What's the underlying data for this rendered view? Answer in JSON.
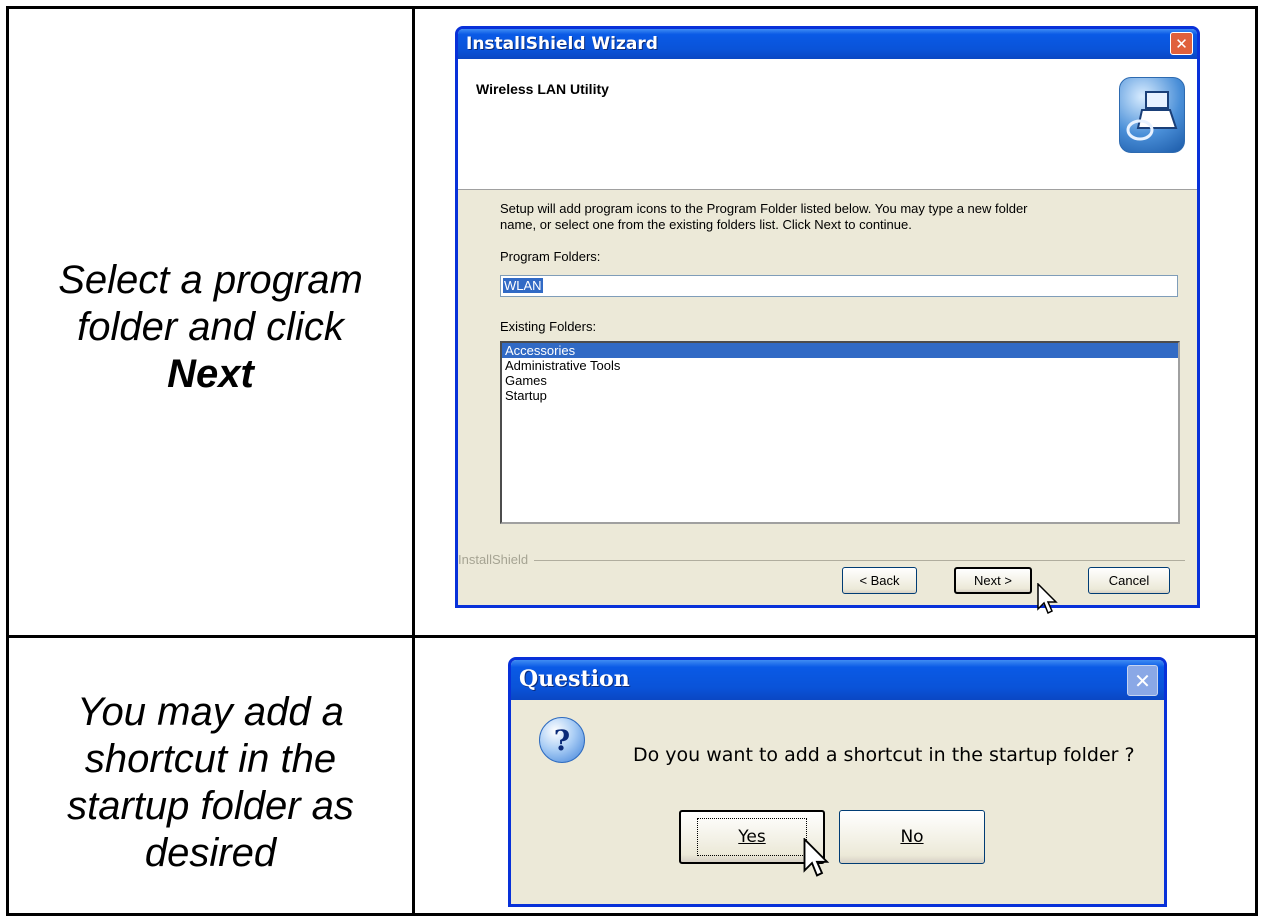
{
  "row1": {
    "instruction_line1": "Select a program",
    "instruction_line2": "folder and click",
    "instruction_bold": "Next"
  },
  "row2": {
    "instruction_line1": "You may add a",
    "instruction_line2": "shortcut in the",
    "instruction_line3": "startup folder as",
    "instruction_line4": "desired"
  },
  "wizard": {
    "title": "InstallShield Wizard",
    "close_icon": "close-icon",
    "header_title": "Wireless LAN Utility",
    "description_line1": "Setup will add program icons to the Program Folder listed below.  You may type a new folder",
    "description_line2": "name, or select one from the existing folders list.  Click Next to continue.",
    "program_folders_label": "Program Folders:",
    "program_folder_value": "WLAN",
    "existing_folders_label": "Existing Folders:",
    "existing_folders": [
      "Accessories",
      "Administrative Tools",
      "Games",
      "Startup"
    ],
    "selected_folder": "Accessories",
    "brand": "InstallShield",
    "back_label": "< Back",
    "next_label": "Next >",
    "cancel_label": "Cancel"
  },
  "question": {
    "title": "Question",
    "message": "Do you want to add a shortcut in the startup folder ?",
    "yes_label": "Yes",
    "no_label": "No",
    "icon": "question-icon"
  }
}
